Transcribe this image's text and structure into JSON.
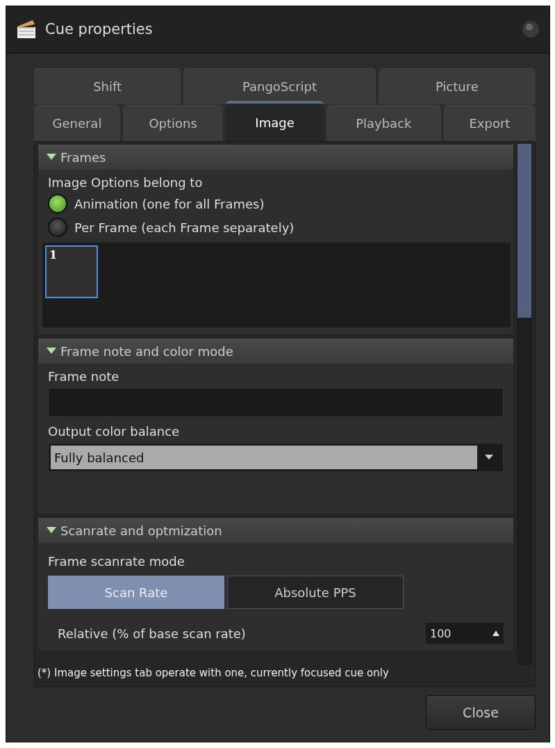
{
  "window": {
    "title": "Cue properties"
  },
  "tab_rows": [
    [
      {
        "label": "Shift",
        "selected": false
      },
      {
        "label": "PangoScript",
        "selected": false
      },
      {
        "label": "Picture",
        "selected": false
      }
    ],
    [
      {
        "label": "General",
        "selected": false
      },
      {
        "label": "Options",
        "selected": false
      },
      {
        "label": "Image",
        "selected": true
      },
      {
        "label": "Playback",
        "selected": false
      },
      {
        "label": "Export",
        "selected": false
      }
    ]
  ],
  "sections": [
    {
      "kind": "frames",
      "title": "Frames",
      "expanded": true,
      "label": "Image Options belong to",
      "options": [
        {
          "label": "Animation (one for all Frames)",
          "selected": true
        },
        {
          "label": "Per Frame (each Frame separately)",
          "selected": false
        }
      ],
      "frames": [
        {
          "label": "1",
          "selected": true
        }
      ]
    },
    {
      "kind": "note",
      "title": "Frame note and color mode",
      "expanded": true,
      "note_label": "Frame note",
      "balance_label": "Output color balance",
      "balance_value": "Fully balanced"
    },
    {
      "kind": "scanrate",
      "title": "Scanrate and optmization",
      "expanded": true,
      "mode_label": "Frame scanrate mode",
      "modes": [
        {
          "label": "Scan Rate",
          "selected": true
        },
        {
          "label": "Absolute PPS",
          "selected": false
        }
      ],
      "relative_label": "Relative (% of base scan rate)",
      "relative_value": "100"
    }
  ],
  "footnote": "(*) Image settings tab operate with one,  currently focused cue only",
  "buttons": [
    "Close"
  ]
}
